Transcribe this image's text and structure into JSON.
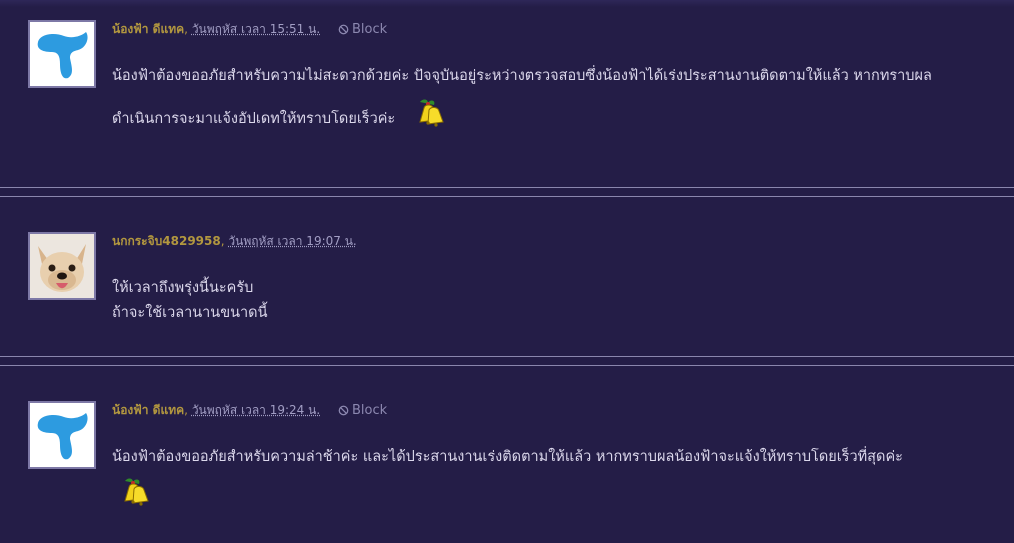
{
  "comments": [
    {
      "author": "น้องฟ้า ดีแทค",
      "separator": ",",
      "date": "วันพฤหัส เวลา 15:51 น.",
      "block_label": "Block",
      "lines": [
        "น้องฟ้าต้องขออภัยสำหรับความไม่สะดวกด้วยค่ะ ปัจจุบันอยู่ระหว่างตรวจสอบซึ่งน้องฟ้าได้เร่งประสานงานติดตามให้แล้ว หากทราบผล",
        "ดำเนินการจะมาแจ้งอัปเดทให้ทราบโดยเร็วค่ะ"
      ],
      "avatar_icon": "dtac-logo-icon",
      "sticker_icon": "bell-icon"
    },
    {
      "author": "นกกระจิบ4829958",
      "separator": ",",
      "date": "วันพฤหัส เวลา 19:07 น.",
      "lines": [
        "ให้เวลาถึงพรุ่งนี้นะครับ",
        "ถ้าจะใช้เวลานานขนาดนี้"
      ],
      "avatar_icon": "french-bulldog-avatar-icon"
    },
    {
      "author": "น้องฟ้า ดีแทค",
      "separator": ",",
      "date": "วันพฤหัส เวลา 19:24 น.",
      "block_label": "Block",
      "lines": [
        "น้องฟ้าต้องขออภัยสำหรับความล่าช้าค่ะ และได้ประสานงานเร่งติดตามให้แล้ว หากทราบผลน้องฟ้าจะแจ้งให้ทราบโดยเร็วที่สุดค่ะ"
      ],
      "avatar_icon": "dtac-logo-icon",
      "sticker_icon": "bell-icon"
    }
  ],
  "colors": {
    "background": "#241d47",
    "author": "#b2973f",
    "date": "#a29ec4",
    "text": "#dcd8ec",
    "divider": "#8a86ad",
    "dtac_blue": "#2d9be0"
  }
}
